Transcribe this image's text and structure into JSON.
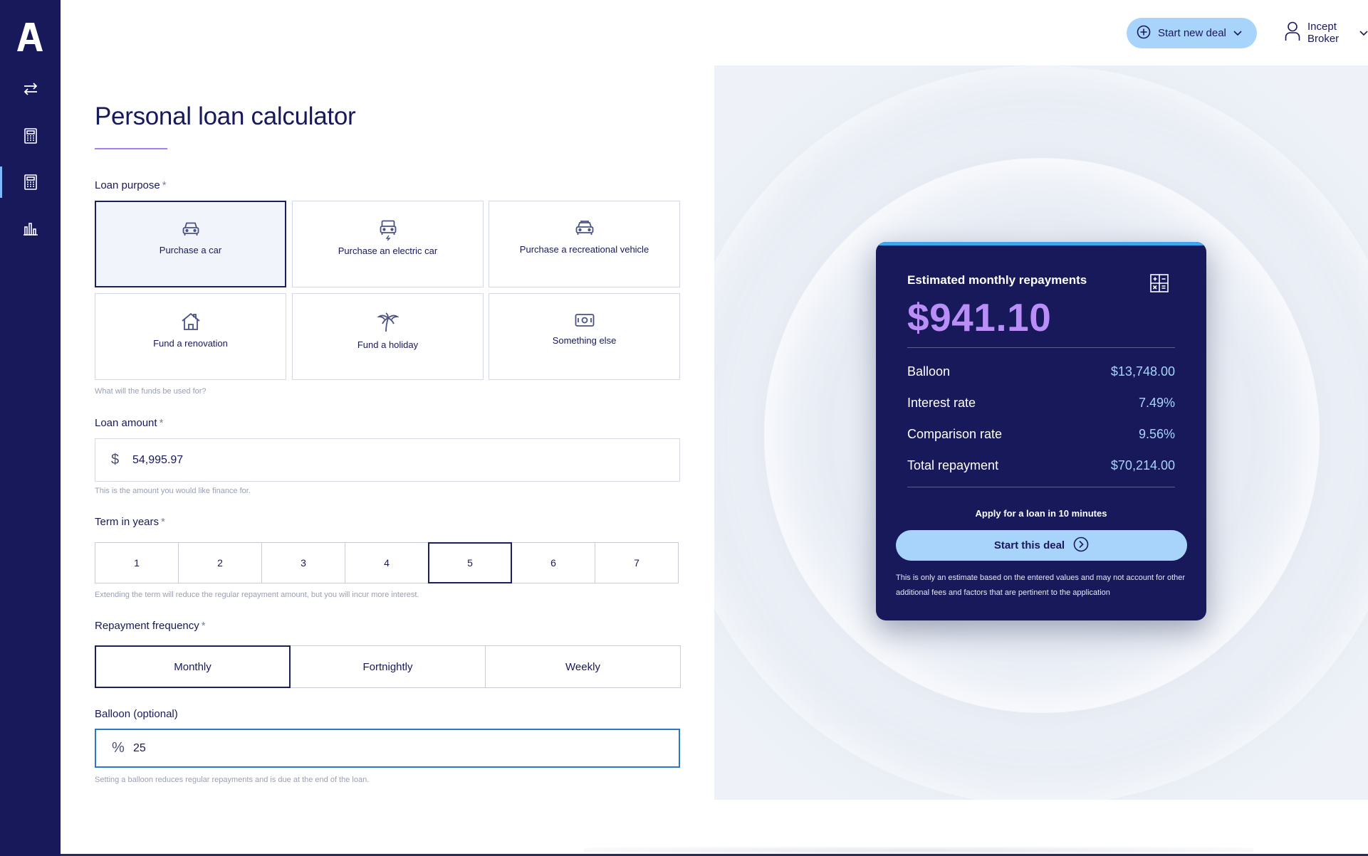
{
  "header": {
    "new_deal_label": "Start new deal",
    "user_name": "Incept Broker"
  },
  "page": {
    "title": "Personal loan calculator"
  },
  "loan_purpose": {
    "label": "Loan purpose",
    "required_mark": "*",
    "hint": "What will the funds be used for?",
    "options": [
      {
        "label": "Purchase a car",
        "icon": "car-icon",
        "selected": true
      },
      {
        "label": "Purchase an electric car",
        "icon": "electric-car-icon",
        "selected": false
      },
      {
        "label": "Purchase a recreational vehicle",
        "icon": "recreational-vehicle-icon",
        "selected": false
      },
      {
        "label": "Fund a renovation",
        "icon": "house-icon",
        "selected": false
      },
      {
        "label": "Fund a holiday",
        "icon": "palm-tree-icon",
        "selected": false
      },
      {
        "label": "Something else",
        "icon": "cash-icon",
        "selected": false
      }
    ]
  },
  "loan_amount": {
    "label": "Loan amount",
    "required_mark": "*",
    "prefix": "$",
    "value": "54,995.97",
    "hint": "This is the amount you would like finance for."
  },
  "term": {
    "label": "Term in years",
    "required_mark": "*",
    "options": [
      "1",
      "2",
      "3",
      "4",
      "5",
      "6",
      "7"
    ],
    "selected": "5",
    "hint": "Extending the term will reduce the regular repayment amount, but you will incur more interest."
  },
  "frequency": {
    "label": "Repayment frequency",
    "required_mark": "*",
    "options": [
      "Monthly",
      "Fortnightly",
      "Weekly"
    ],
    "selected": "Monthly"
  },
  "balloon": {
    "label": "Balloon (optional)",
    "prefix": "%",
    "value": "25",
    "hint": "Setting a balloon reduces regular repayments and is due at the end of the loan."
  },
  "summary": {
    "title": "Estimated monthly repayments",
    "amount": "$941.10",
    "rows": [
      {
        "label": "Balloon",
        "value": "$13,748.00"
      },
      {
        "label": "Interest rate",
        "value": "7.49%"
      },
      {
        "label": "Comparison rate",
        "value": "9.56%"
      },
      {
        "label": "Total repayment",
        "value": "$70,214.00"
      }
    ],
    "apply_text": "Apply for a loan in 10 minutes",
    "start_label": "Start this deal",
    "disclaimer": "This is only an estimate based on the entered values and may not account for other additional fees and factors that are pertinent to the application"
  },
  "colors": {
    "navy": "#17195b",
    "accent_blue": "#a8d4fb",
    "accent_purple": "#b98ff7",
    "card_top_bar": "#40a5ec"
  }
}
